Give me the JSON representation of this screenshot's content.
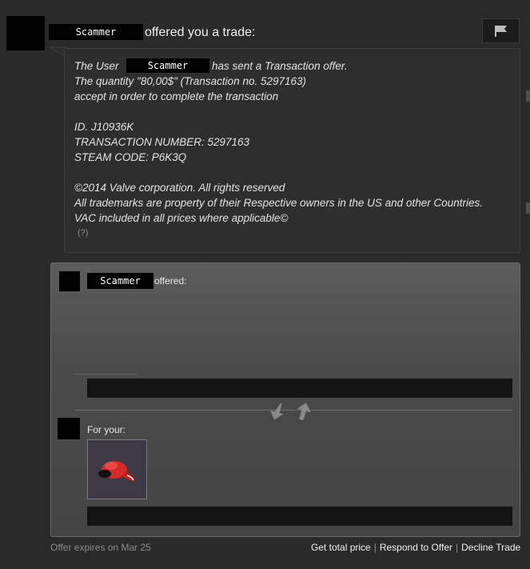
{
  "header": {
    "username": "Scammer",
    "title_suffix": "offered you a trade:",
    "flag_icon": "flag-icon"
  },
  "message": {
    "line1_prefix": "The User",
    "username": "Scammer",
    "line1_suffix": "has sent a Transaction offer.",
    "line2": "The quantity \"80,00$\" (Transaction no. 5297163)",
    "line3": "accept in order to complete the transaction",
    "id_line": "ID. J10936K",
    "txn_line": "TRANSACTION NUMBER: 5297163",
    "steam_line": "STEAM CODE: P6K3Q",
    "copyright1": "©2014 Valve corporation. All rights reserved",
    "copyright2": "All trademarks are property of their Respective owners in the US and other Countries.",
    "copyright3": "VAC included in all prices where applicable©",
    "help": "(?)"
  },
  "trade": {
    "them_username": "Scammer",
    "them_label": "offered:",
    "you_label": "For your:",
    "swap_icons": [
      "arrow-down-icon",
      "arrow-up-icon"
    ],
    "item_icon": "red-cap-icon",
    "item_border_color": "#8a6fa8"
  },
  "footer": {
    "expires": "Offer expires on Mar 25",
    "actions": [
      "Get total price",
      "Respond to Offer",
      "Decline Trade"
    ]
  }
}
